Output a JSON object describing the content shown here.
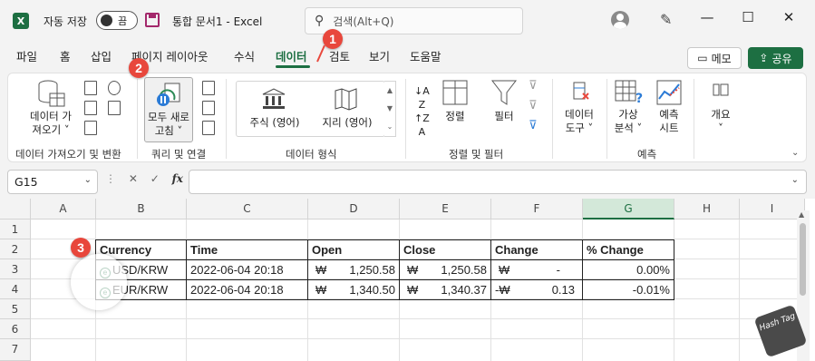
{
  "titlebar": {
    "app_icon": "X",
    "autosave_label": "자동 저장",
    "autosave_state": "끔",
    "doc_title": "통합 문서1 - Excel",
    "search_placeholder": "검색(Alt+Q)",
    "minimize": "—",
    "maximize": "☐",
    "close": "✕"
  },
  "tabs": [
    "파일",
    "홈",
    "삽입",
    "페이지 레이아웃",
    "수식",
    "데이터",
    "검토",
    "보기",
    "도움말"
  ],
  "active_tab": "데이터",
  "memo_label": "메모",
  "share_label": "공유",
  "ribbon": {
    "get_data_line1": "데이터 가",
    "get_data_line2": "져오기 ˅",
    "refresh_all_line1": "모두 새로",
    "refresh_all_line2": "고침 ˅",
    "stocks_label": "주식 (영어)",
    "geography_label": "지리 (영어)",
    "sort_label": "정렬",
    "filter_label": "필터",
    "data_tools_line1": "데이터",
    "data_tools_line2": "도구 ˅",
    "whatif_line1": "가상",
    "whatif_line2": "분석 ˅",
    "forecast_sheet_line1": "예측",
    "forecast_sheet_line2": "시트",
    "outline_label": "개요",
    "outline_chev": "˅",
    "groups": {
      "get_transform": "데이터 가져오기 및 변환",
      "queries": "쿼리 및 연결",
      "data_types": "데이터 형식",
      "sort_filter": "정렬 및 필터",
      "forecast": "예측"
    }
  },
  "namebox": "G15",
  "formula_bar_value": "",
  "fx_label": "fx",
  "columns": [
    "A",
    "B",
    "C",
    "D",
    "E",
    "F",
    "G",
    "H",
    "I"
  ],
  "selected_column": "G",
  "rows": [
    "1",
    "2",
    "3",
    "4",
    "5",
    "6",
    "7"
  ],
  "table": {
    "headers": [
      "Currency",
      "Time",
      "Open",
      "Close",
      "Change",
      "% Change"
    ],
    "rows": [
      {
        "currency": "USD/KRW",
        "time": "2022-06-04 20:18",
        "open_sym": "₩",
        "open": "1,250.58",
        "close_sym": "₩",
        "close": "1,250.58",
        "change_sym": "₩",
        "change": "-",
        "pct": "0.00%"
      },
      {
        "currency": "EUR/KRW",
        "time": "2022-06-04 20:18",
        "open_sym": "₩",
        "open": "1,340.50",
        "close_sym": "₩",
        "close": "1,340.37",
        "change_sym": "-₩",
        "change": "0.13",
        "pct": "-0.01%"
      }
    ]
  },
  "callouts": [
    "1",
    "2",
    "3"
  ],
  "watermark": "Hash Tag",
  "colors": {
    "accent": "#1d6f42",
    "badge": "#e8473c"
  }
}
